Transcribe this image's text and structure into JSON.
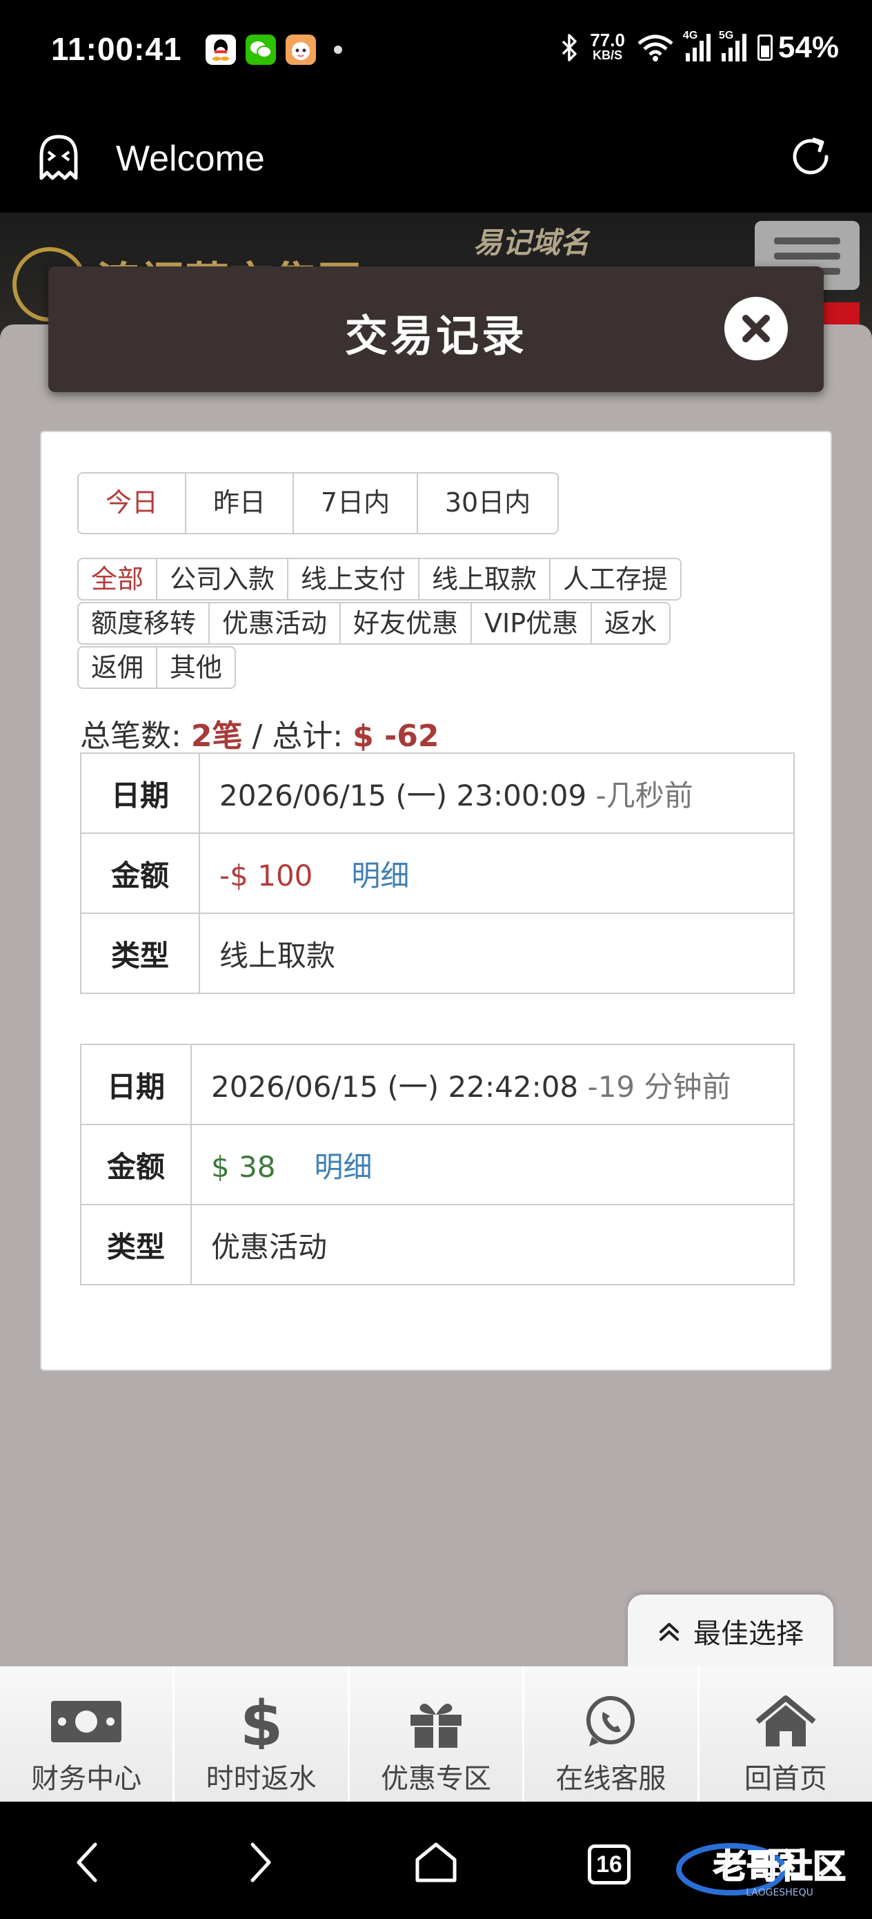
{
  "status_bar": {
    "time": "11:00:41",
    "speed_value": "77.0",
    "speed_unit": "KB/S",
    "net1": "4G",
    "net2": "5G",
    "battery": "54%"
  },
  "browser": {
    "title": "Welcome"
  },
  "site": {
    "name": "澳门葡京集团",
    "domain_label": "易记域名"
  },
  "modal": {
    "title": "交易记录",
    "range_tabs": [
      {
        "label": "今日",
        "active": true
      },
      {
        "label": "昨日",
        "active": false
      },
      {
        "label": "7日内",
        "active": false
      },
      {
        "label": "30日内",
        "active": false
      }
    ],
    "type_tag_rows": [
      [
        {
          "label": "全部",
          "active": true
        },
        {
          "label": "公司入款"
        },
        {
          "label": "线上支付"
        },
        {
          "label": "线上取款"
        },
        {
          "label": "人工存提"
        }
      ],
      [
        {
          "label": "额度移转"
        },
        {
          "label": "优惠活动"
        },
        {
          "label": "好友优惠"
        },
        {
          "label": "VIP优惠"
        },
        {
          "label": "返水"
        }
      ],
      [
        {
          "label": "返佣"
        },
        {
          "label": "其他"
        }
      ]
    ],
    "summary": {
      "count_label": "总笔数:",
      "count_value": "2笔",
      "sep": " / ",
      "total_label": "总计:",
      "total_value": "$ -62"
    },
    "records": [
      {
        "date_key": "日期",
        "date": "2026/06/15 (一) 23:00:09",
        "relative": "-几秒前",
        "amount_key": "金额",
        "amount": "-$ 100",
        "amount_sign": "negative",
        "detail": "明细",
        "type_key": "类型",
        "type": "线上取款"
      },
      {
        "date_key": "日期",
        "date": "2026/06/15 (一) 22:42:08",
        "relative": "-19 分钟前",
        "amount_key": "金额",
        "amount": "$ 38",
        "amount_sign": "positive",
        "detail": "明细",
        "type_key": "类型",
        "type": "优惠活动"
      }
    ]
  },
  "best_choice": {
    "label": "最佳选择"
  },
  "bottom_nav": [
    {
      "label": "财务中心",
      "icon": "money-icon"
    },
    {
      "label": "时时返水",
      "icon": "dollar-icon"
    },
    {
      "label": "优惠专区",
      "icon": "gift-icon"
    },
    {
      "label": "在线客服",
      "icon": "whatsapp-icon"
    },
    {
      "label": "回首页",
      "icon": "home-icon"
    }
  ],
  "system_nav": {
    "tab_count": "16"
  },
  "watermark": {
    "text": "老哥社区",
    "sub": "LAOGESHEQU"
  },
  "colors": {
    "accent_red": "#b43b3b",
    "positive_green": "#3d7a3b",
    "link_blue": "#3f7fb3",
    "modal_header": "#3a3130",
    "overlay": "#b2acac"
  }
}
